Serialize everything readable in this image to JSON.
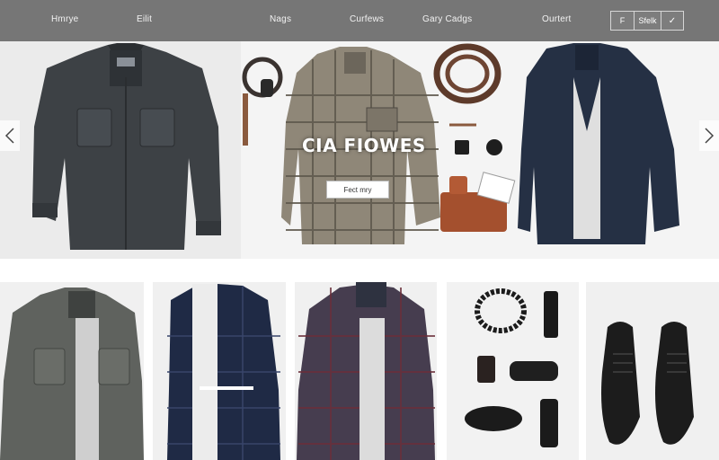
{
  "nav": {
    "items": [
      "Hmrye",
      "Eilit",
      "Nags",
      "Curfews",
      "Gary Cadgs",
      "Ourtert"
    ],
    "tools": {
      "bag_label": "F",
      "text_label": "Sfelk",
      "check_label": "✓"
    }
  },
  "hero": {
    "title": "CIA FIOWES",
    "button_label": "Fect mry"
  },
  "colors": {
    "nav_background": "#767676",
    "hero_background": "#efefef"
  }
}
